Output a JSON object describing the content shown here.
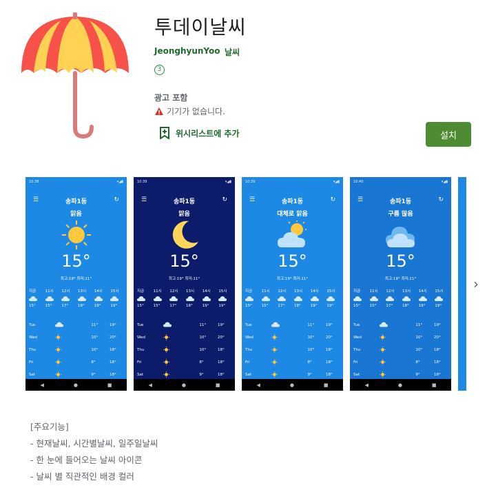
{
  "app": {
    "title": "투데이날씨",
    "developer": "JeonghyunYoo",
    "category": "날씨",
    "rating_badge": "3",
    "ads_label": "광고 포함",
    "warning": "기기가 없습니다.",
    "wishlist_label": "위시리스트에 추가",
    "install_label": "설치"
  },
  "colors": {
    "accent_green": "#1e6a2e",
    "install_bg": "#4e8c34",
    "sky_blue": "#1e88e5",
    "night_navy": "#0d1b6b"
  },
  "screenshots": [
    {
      "bg": "#1e88e5",
      "status_time": "10:38",
      "location": "송파1동",
      "condition": "맑음",
      "icon": "sun-icon",
      "temp": "15°",
      "hilo": "최고:19°  최저:11°",
      "hours": [
        {
          "t": "지금",
          "v": "15°"
        },
        {
          "t": "11시",
          "v": "15°"
        },
        {
          "t": "12시",
          "v": "17°"
        },
        {
          "t": "13시",
          "v": "18°"
        },
        {
          "t": "14시",
          "v": "19°"
        },
        {
          "t": "15시",
          "v": "19°"
        }
      ],
      "days": [
        {
          "d": "Tue",
          "icon": "cloud",
          "lo": "11°",
          "hi": "19°"
        },
        {
          "d": "Wed",
          "icon": "sun",
          "lo": "10°",
          "hi": "20°"
        },
        {
          "d": "Thu",
          "icon": "sun",
          "lo": "10°",
          "hi": "18°"
        },
        {
          "d": "Fri",
          "icon": "sun",
          "lo": "8°",
          "hi": "18°"
        },
        {
          "d": "Sat",
          "icon": "sun",
          "lo": "9°",
          "hi": "18°"
        }
      ]
    },
    {
      "bg": "#0d1b6b",
      "status_time": "10:39",
      "location": "송파1동",
      "condition": "맑음",
      "icon": "moon-icon",
      "temp": "15°",
      "hilo": "최고:19°  최저:11°",
      "hours": [
        {
          "t": "지금",
          "v": "15°"
        },
        {
          "t": "11시",
          "v": "15°"
        },
        {
          "t": "12시",
          "v": "17°"
        },
        {
          "t": "13시",
          "v": "18°"
        },
        {
          "t": "14시",
          "v": "19°"
        },
        {
          "t": "15시",
          "v": "19°"
        }
      ],
      "days": [
        {
          "d": "Tue",
          "icon": "cloud",
          "lo": "11°",
          "hi": "19°"
        },
        {
          "d": "Wed",
          "icon": "sun",
          "lo": "10°",
          "hi": "20°"
        },
        {
          "d": "Thu",
          "icon": "sun",
          "lo": "10°",
          "hi": "18°"
        },
        {
          "d": "Fri",
          "icon": "sun",
          "lo": "8°",
          "hi": "18°"
        },
        {
          "d": "Sat",
          "icon": "sun",
          "lo": "9°",
          "hi": "18°"
        }
      ]
    },
    {
      "bg": "#1e88e5",
      "status_time": "10:39",
      "location": "송파1동",
      "condition": "대체로 맑음",
      "icon": "partly-cloudy-icon",
      "temp": "15°",
      "hilo": "최고:19°  최저:11°",
      "hours": [
        {
          "t": "지금",
          "v": "15°"
        },
        {
          "t": "11시",
          "v": "15°"
        },
        {
          "t": "12시",
          "v": "17°"
        },
        {
          "t": "13시",
          "v": "18°"
        },
        {
          "t": "14시",
          "v": "19°"
        },
        {
          "t": "15시",
          "v": "19°"
        }
      ],
      "days": [
        {
          "d": "Tue",
          "icon": "cloud",
          "lo": "11°",
          "hi": "19°"
        },
        {
          "d": "Wed",
          "icon": "sun",
          "lo": "10°",
          "hi": "20°"
        },
        {
          "d": "Thu",
          "icon": "sun",
          "lo": "10°",
          "hi": "18°"
        },
        {
          "d": "Fri",
          "icon": "sun",
          "lo": "8°",
          "hi": "18°"
        },
        {
          "d": "Sat",
          "icon": "sun",
          "lo": "9°",
          "hi": "18°"
        }
      ]
    },
    {
      "bg": "#1976d2",
      "status_time": "10:40",
      "location": "송파1동",
      "condition": "구름 많음",
      "icon": "cloud-icon",
      "temp": "15°",
      "hilo": "최고:19°  최저:11°",
      "hours": [
        {
          "t": "지금",
          "v": "15°"
        },
        {
          "t": "11시",
          "v": "15°"
        },
        {
          "t": "12시",
          "v": "17°"
        },
        {
          "t": "13시",
          "v": "18°"
        },
        {
          "t": "14시",
          "v": "19°"
        },
        {
          "t": "15시",
          "v": "19°"
        }
      ],
      "days": [
        {
          "d": "Tue",
          "icon": "cloud",
          "lo": "11°",
          "hi": "19°"
        },
        {
          "d": "Wed",
          "icon": "sun",
          "lo": "10°",
          "hi": "20°"
        },
        {
          "d": "Thu",
          "icon": "sun",
          "lo": "10°",
          "hi": "18°"
        },
        {
          "d": "Fri",
          "icon": "sun",
          "lo": "8°",
          "hi": "18°"
        },
        {
          "d": "Sat",
          "icon": "sun",
          "lo": "9°",
          "hi": "18°"
        }
      ]
    }
  ],
  "description": {
    "heading": "[주요기능]",
    "lines": [
      "- 현재날씨, 시간별날씨, 일주일날씨",
      "- 한 눈에 들어오는 날씨 아이콘",
      "- 날씨 별 직관적인 배경 컬러"
    ]
  }
}
